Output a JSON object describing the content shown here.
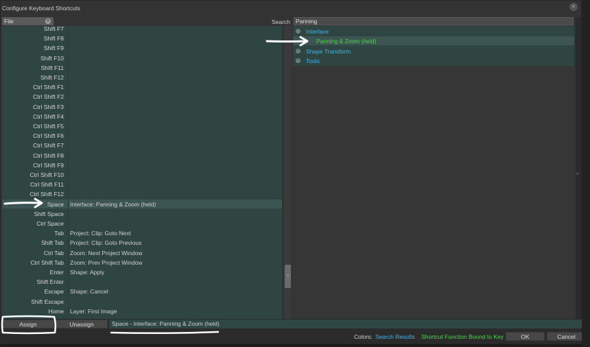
{
  "window": {
    "title": "Configure Keyboard Shortcuts",
    "close_glyph": "×"
  },
  "file_select": {
    "value": "File"
  },
  "search": {
    "label": "Search",
    "value": "Panning"
  },
  "shortcuts": [
    {
      "key": "Shift F7",
      "action": ""
    },
    {
      "key": "Shift F8",
      "action": ""
    },
    {
      "key": "Shift F9",
      "action": ""
    },
    {
      "key": "Shift F10",
      "action": ""
    },
    {
      "key": "Shift F11",
      "action": ""
    },
    {
      "key": "Shift F12",
      "action": ""
    },
    {
      "key": "Ctrl Shift F1",
      "action": ""
    },
    {
      "key": "Ctrl Shift F2",
      "action": ""
    },
    {
      "key": "Ctrl Shift F3",
      "action": ""
    },
    {
      "key": "Ctrl Shift F4",
      "action": ""
    },
    {
      "key": "Ctrl Shift F5",
      "action": ""
    },
    {
      "key": "Ctrl Shift F6",
      "action": ""
    },
    {
      "key": "Ctrl Shift F7",
      "action": ""
    },
    {
      "key": "Ctrl Shift F8",
      "action": ""
    },
    {
      "key": "Ctrl Shift F9",
      "action": ""
    },
    {
      "key": "Ctrl Shift F10",
      "action": ""
    },
    {
      "key": "Ctrl Shift F11",
      "action": ""
    },
    {
      "key": "Ctrl Shift F12",
      "action": ""
    },
    {
      "key": "Space",
      "action": "Interface: Panning & Zoom (held)",
      "selected": true
    },
    {
      "key": "Shift Space",
      "action": ""
    },
    {
      "key": "Ctrl Space",
      "action": ""
    },
    {
      "key": "Tab",
      "action": "Project: Clip: Goto Next"
    },
    {
      "key": "Shift Tab",
      "action": "Project: Clip: Goto Previous"
    },
    {
      "key": "Ctrl Tab",
      "action": "Zoom: Next Project Window"
    },
    {
      "key": "Ctrl Shift Tab",
      "action": "Zoom: Prev Project Window"
    },
    {
      "key": "Enter",
      "action": "Shape: Apply"
    },
    {
      "key": "Shift Enter",
      "action": ""
    },
    {
      "key": "Escape",
      "action": "Shape: Cancel"
    },
    {
      "key": "Shift Escape",
      "action": ""
    },
    {
      "key": "Home",
      "action": "Layer: First Image"
    }
  ],
  "tree": [
    {
      "label": "Interface",
      "bullet": "−",
      "level": 0,
      "type": "search"
    },
    {
      "label": "Panning & Zoom (held)",
      "bullet": "",
      "level": 1,
      "type": "bound",
      "selected": true
    },
    {
      "label": "Shape Transform",
      "bullet": "+",
      "level": 0,
      "type": "search"
    },
    {
      "label": "Tools",
      "bullet": "+",
      "level": 0,
      "type": "search"
    }
  ],
  "buttons": {
    "assign": "Assign",
    "unassign": "Unassign",
    "ok": "OK",
    "cancel": "Cancel"
  },
  "status": {
    "text": "Space - Interface: Panning & Zoom (held)"
  },
  "legend": {
    "label": "Colors:",
    "search_results": "Search Results",
    "bound": "Shortcut Function Bound to Key"
  },
  "colors": {
    "search_results": "#3fb6e8",
    "bound": "#4dd64a",
    "list_bg": "#2e4542",
    "annotation": "#ffffff"
  }
}
